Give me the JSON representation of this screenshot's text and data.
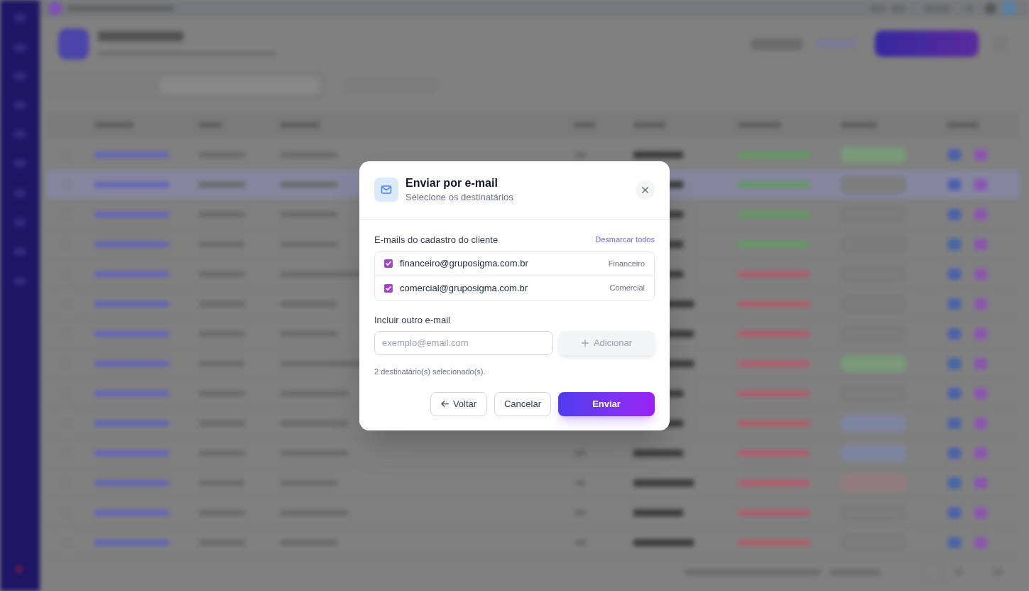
{
  "dialog": {
    "title": "Enviar por e-mail",
    "subtitle": "Selecione os destinatários",
    "registered_emails": {
      "label": "E-mails do cadastro do cliente",
      "toggle_all_link": "Desmarcar todos",
      "items": [
        {
          "email": "financeiro@gruposigma.com.br",
          "tag": "Financeiro",
          "checked": true
        },
        {
          "email": "comercial@gruposigma.com.br",
          "tag": "Comercial",
          "checked": true
        }
      ]
    },
    "add_email": {
      "label": "Incluir outro e-mail",
      "placeholder": "exemplo@email.com",
      "button": {
        "label": "Adicionar",
        "disabled": true
      }
    },
    "summary": "2 destinatário(s) selecionado(s).",
    "buttons": [
      {
        "kind": "back",
        "label": "Voltar"
      },
      {
        "kind": "secondary",
        "label": "Cancelar"
      },
      {
        "kind": "primary",
        "label": "Enviar"
      }
    ]
  }
}
